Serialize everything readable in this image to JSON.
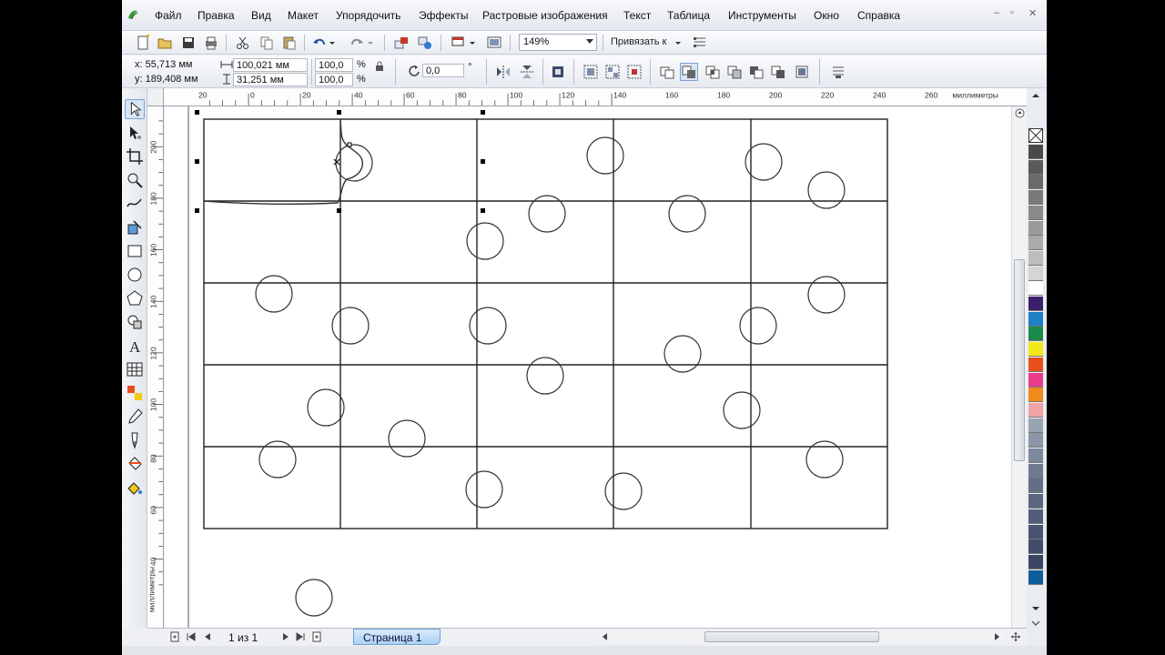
{
  "menu": [
    "Файл",
    "Правка",
    "Вид",
    "Макет",
    "Упорядочить",
    "Эффекты",
    "Растровые изображения",
    "Текст",
    "Таблица",
    "Инструменты",
    "Окно",
    "Справка"
  ],
  "toolbar": {
    "zoom": "149%",
    "snap_label": "Привязать к"
  },
  "propbar": {
    "x": "x: 55,713 мм",
    "y": "y: 189,408 мм",
    "width": "100,021 мм",
    "height": "31,251 мм",
    "scale_w": "100,0",
    "scale_h": "100,0",
    "percent": "%",
    "angle": "0,0",
    "degree": "°"
  },
  "ruler": {
    "unit": "миллиметры",
    "h_ticks": [
      "20",
      "0",
      "20",
      "40",
      "60",
      "80",
      "100",
      "120",
      "140",
      "160",
      "180",
      "200",
      "220",
      "240",
      "260"
    ],
    "v_ticks": [
      "200",
      "180",
      "160",
      "140",
      "120",
      "100",
      "80",
      "60",
      "40"
    ]
  },
  "pagebar": {
    "count": "1 из 1",
    "tab": "Страница 1"
  },
  "palette": [
    "#4a4a4a",
    "#5a5a5a",
    "#6a6a6a",
    "#7a7a7a",
    "#8a8a8a",
    "#9a9a9a",
    "#aaaaaa",
    "#bdbdbd",
    "#d4d4d4",
    "#ffffff",
    "#3c1f6b",
    "#1f7fc7",
    "#1a8a4a",
    "#f3e81a",
    "#e8501a",
    "#e83c8c",
    "#f08a1a",
    "#f2a3a8",
    "#9aa3b3",
    "#8c96a8",
    "#7c889c",
    "#6e7a90",
    "#636f86",
    "#5a667e",
    "#515d76",
    "#49556e",
    "#424e68",
    "#3b4762",
    "#0f5e9a"
  ]
}
